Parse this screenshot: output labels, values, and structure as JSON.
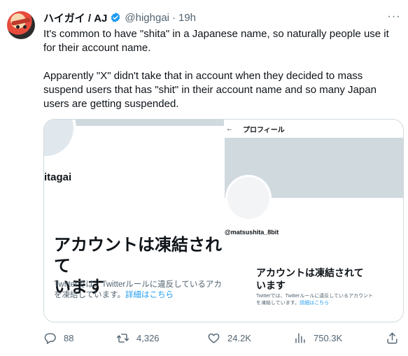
{
  "tweet": {
    "display_name": "ハイガイ / AJ",
    "handle": "@highgai",
    "separator": "·",
    "time": "19h",
    "more_label": "···",
    "text": "It's common to have \"shita\" in a Japanese name, so naturally people use it for their account name.\n\nApparently \"X\" didn't take that in account when they decided to mass suspend users that has \"shit\" in their account name and so many Japan users are getting suspended."
  },
  "media": {
    "left": {
      "username": "itagai",
      "headline": "アカウントは凍結されて\nいます",
      "body": "Twitterでは、Twitterルールに違反しているアカ\nを凍結しています。",
      "link": "詳細はこちら"
    },
    "right": {
      "back": "←",
      "page_title": "プロフィール",
      "username": "@matsushita_8bit",
      "headline": "アカウントは凍結されて\nいます",
      "body": "Twitterでは、Twitterルールに違反しているアカウント\nを凍結しています。",
      "link": "詳細はこちら"
    }
  },
  "actions": {
    "replies": "88",
    "retweets": "4,326",
    "likes": "24.2K",
    "views": "750.3K"
  },
  "icons": {
    "verified": "verified-badge-icon",
    "reply": "reply-icon",
    "retweet": "retweet-icon",
    "like": "heart-icon",
    "views": "views-icon",
    "share": "share-icon"
  },
  "colors": {
    "accent": "#1d9bf0",
    "secondary_text": "#536471",
    "border": "#cfd9de"
  }
}
